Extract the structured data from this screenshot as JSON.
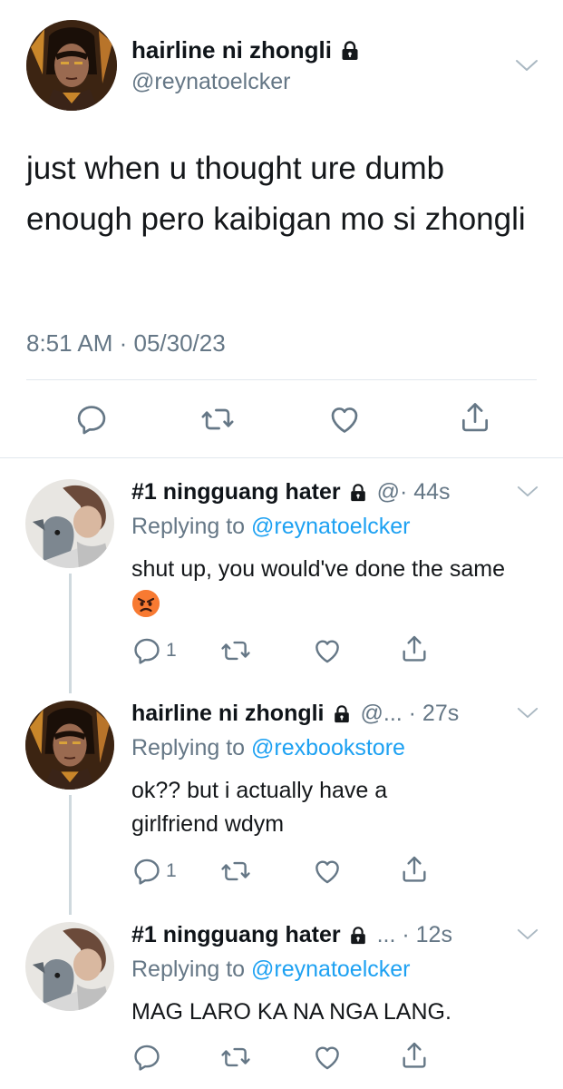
{
  "main_tweet": {
    "display_name": "hairline ni zhongli",
    "handle": "@reynatoelcker",
    "text": "just when u thought ure dumb enough pero kaibigan mo si zhongli",
    "timestamp": "8:51 AM · 05/30/23"
  },
  "replies": [
    {
      "display_name": "#1 ningguang hater",
      "meta": "@· 44s",
      "replying_prefix": "Replying to ",
      "replying_to": "@reynatoelcker",
      "text": "shut up, you would've done the same",
      "emoji": "angry-face",
      "reply_count": "1"
    },
    {
      "display_name": "hairline ni zhongli",
      "meta": "@... · 27s",
      "replying_prefix": "Replying to ",
      "replying_to": "@rexbookstore",
      "text": "ok?? but i actually have a girlfriend wdym",
      "reply_count": "1"
    },
    {
      "display_name": "#1 ningguang hater",
      "meta": "... · 12s",
      "replying_prefix": "Replying to ",
      "replying_to": "@reynatoelcker",
      "text": "MAG LARO KA NA NGA LANG.",
      "reply_count": ""
    }
  ],
  "colors": {
    "link": "#1da1f2",
    "secondary_text": "#657786",
    "divider": "#e1e8ed",
    "thread_line": "#cfd9de"
  },
  "icons": [
    "lock-icon",
    "chevron-down-icon",
    "reply-icon",
    "retweet-icon",
    "like-icon",
    "share-icon",
    "angry-face-emoji"
  ]
}
